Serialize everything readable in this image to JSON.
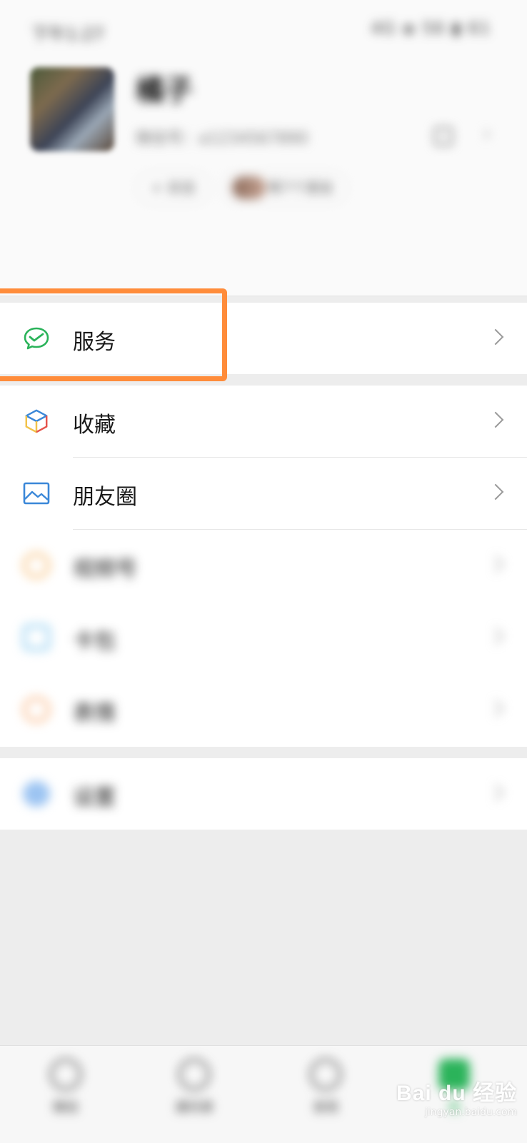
{
  "status_bar": {
    "time": "下午1:27",
    "indicators": "4G ◈ 56 ▮ 61"
  },
  "profile": {
    "nickname": "橘子",
    "wechat_id": "微信号：a1234567890",
    "status_label": "+ 状态",
    "friends_status": "等7个朋友",
    "qr_icon": "qr-code-icon"
  },
  "menu": {
    "service": {
      "label": "服务",
      "icon": "wechat-pay-icon",
      "color": "#2bb35a"
    },
    "favorites": {
      "label": "收藏",
      "icon": "cube-icon"
    },
    "moments": {
      "label": "朋友圈",
      "icon": "image-icon",
      "color": "#3a87d8"
    },
    "channels": {
      "label": "视频号",
      "icon": "channels-icon",
      "color": "#f6b86b"
    },
    "cards": {
      "label": "卡包",
      "icon": "wallet-icon",
      "color": "#7fc6ee"
    },
    "stickers": {
      "label": "表情",
      "icon": "smile-icon",
      "color": "#f8b07a"
    },
    "settings": {
      "label": "设置",
      "icon": "gear-icon",
      "color": "#7fb3ee"
    }
  },
  "tabs": [
    {
      "label": "微信",
      "icon": "chat-icon"
    },
    {
      "label": "通讯录",
      "icon": "contacts-icon"
    },
    {
      "label": "发现",
      "icon": "compass-icon"
    },
    {
      "label": "我",
      "icon": "person-icon",
      "active": true
    }
  ],
  "highlight": {
    "color": "#ff8c3a"
  },
  "watermark": {
    "main": "Bai du 经验",
    "sub": "jingyan.baidu.com"
  }
}
